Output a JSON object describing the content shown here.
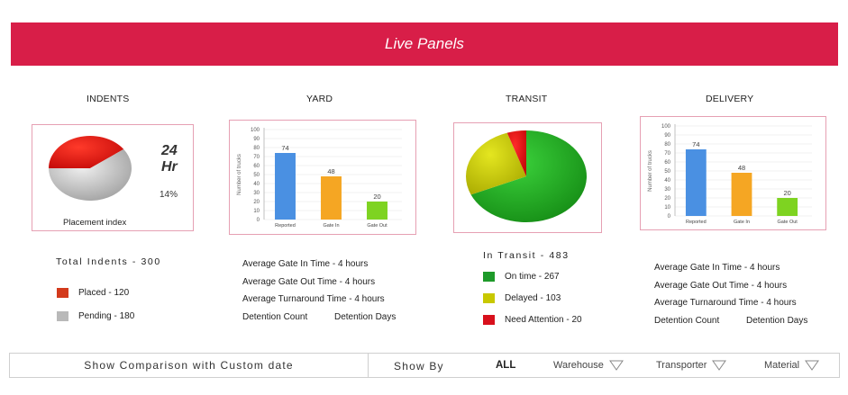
{
  "header": {
    "title": "Live Panels"
  },
  "sections": {
    "indents": "INDENTS",
    "yard": "YARD",
    "transit": "TRANSIT",
    "delivery": "DELIVERY"
  },
  "indents": {
    "time_value": "24",
    "time_unit": "Hr",
    "percent": "14%",
    "placement_label": "Placement index",
    "total": "Total Indents - 300",
    "legend": [
      {
        "label": "Placed - 120",
        "color": "#d33a1c"
      },
      {
        "label": "Pending - 180",
        "color": "#b9b9b9"
      }
    ]
  },
  "yard": {
    "stats": [
      "Average Gate In Time - 4 hours",
      "Average Gate Out Time - 4 hours",
      "Average Turnaround Time - 4 hours"
    ],
    "detention_count": "Detention Count",
    "detention_days": "Detention Days"
  },
  "transit": {
    "total": "In Transit - 483",
    "legend": [
      {
        "label": "On time - 267",
        "color": "#1e9a2a"
      },
      {
        "label": "Delayed - 103",
        "color": "#c8c800"
      },
      {
        "label": "Need Attention - 20",
        "color": "#d8101c"
      }
    ]
  },
  "delivery": {
    "stats": [
      "Average Gate In Time - 4 hours",
      "Average Gate Out Time - 4 hours",
      "Average Turnaround Time - 4 hours"
    ],
    "detention_count": "Detention Count",
    "detention_days": "Detention Days"
  },
  "bottom_bar": {
    "compare_label": "Show Comparison with Custom date",
    "show_by_label": "Show By",
    "all_label": "ALL",
    "filters": [
      "Warehouse",
      "Transporter",
      "Material"
    ]
  },
  "chart_data": [
    {
      "type": "pie",
      "title": "",
      "slices": [
        {
          "label": "Placed",
          "value": 120,
          "color": "#d8120e"
        },
        {
          "label": "Pending",
          "value": 180,
          "color": "#c7c7c7"
        }
      ]
    },
    {
      "type": "bar",
      "categories": [
        "Reported",
        "Gate In",
        "Gate Out"
      ],
      "values": [
        74,
        48,
        20
      ],
      "colors": [
        "#4a90e2",
        "#f5a623",
        "#7ed321"
      ],
      "ylabel": "Number of trucks",
      "ylim": [
        0,
        100
      ],
      "yticks": [
        0,
        10,
        20,
        30,
        40,
        50,
        60,
        70,
        80,
        90,
        100
      ]
    },
    {
      "type": "pie",
      "title": "",
      "slices": [
        {
          "label": "On time",
          "value": 267,
          "color": "#1e9a1e"
        },
        {
          "label": "Delayed",
          "value": 103,
          "color": "#c4c800"
        },
        {
          "label": "Need Attention",
          "value": 20,
          "color": "#d80f10"
        }
      ]
    },
    {
      "type": "bar",
      "categories": [
        "Reported",
        "Gate In",
        "Gate Out"
      ],
      "values": [
        74,
        48,
        20
      ],
      "colors": [
        "#4a90e2",
        "#f5a623",
        "#7ed321"
      ],
      "ylabel": "Number of trucks",
      "ylim": [
        0,
        100
      ],
      "yticks": [
        0,
        10,
        20,
        30,
        40,
        50,
        60,
        70,
        80,
        90,
        100
      ]
    }
  ]
}
